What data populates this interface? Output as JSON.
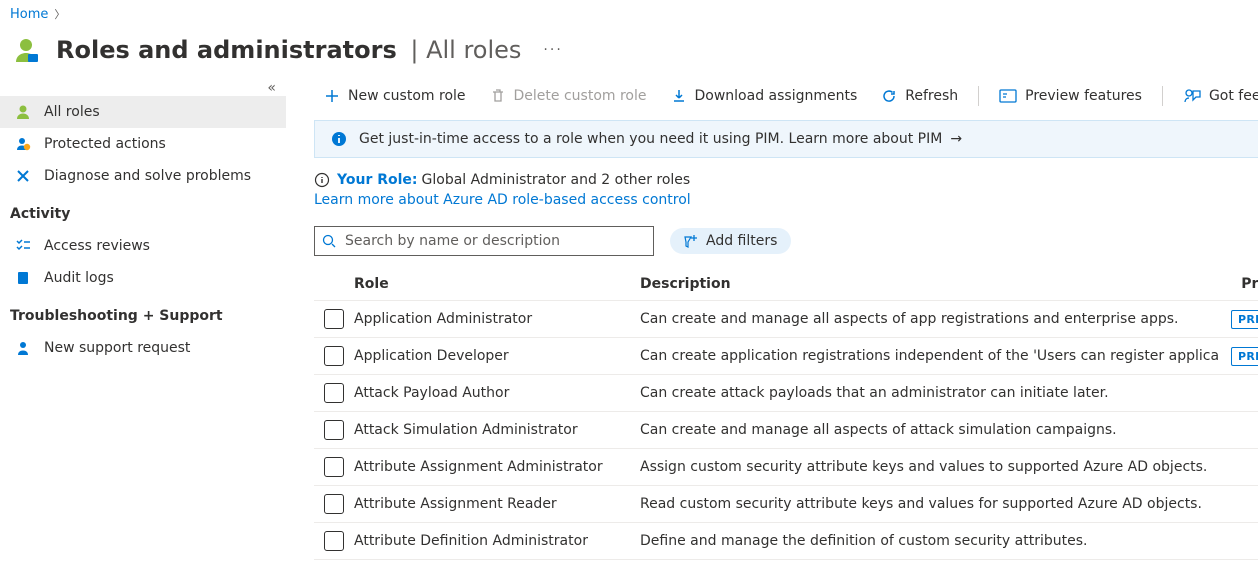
{
  "breadcrumb": {
    "home": "Home"
  },
  "header": {
    "title": "Roles and administrators",
    "subtitle": "All roles"
  },
  "sidebar": {
    "items": [
      {
        "label": "All roles"
      },
      {
        "label": "Protected actions"
      },
      {
        "label": "Diagnose and solve problems"
      }
    ],
    "sections": [
      {
        "title": "Activity",
        "items": [
          {
            "label": "Access reviews"
          },
          {
            "label": "Audit logs"
          }
        ]
      },
      {
        "title": "Troubleshooting + Support",
        "items": [
          {
            "label": "New support request"
          }
        ]
      }
    ]
  },
  "toolbar": {
    "new_role": "New custom role",
    "delete_role": "Delete custom role",
    "download": "Download assignments",
    "refresh": "Refresh",
    "preview": "Preview features",
    "feedback": "Got feedback?"
  },
  "banner": {
    "text": "Get just-in-time access to a role when you need it using PIM. Learn more about PIM"
  },
  "your_role": {
    "label": "Your Role:",
    "value": "Global Administrator and 2 other roles"
  },
  "learn_link": "Learn more about Azure AD role-based access control",
  "search": {
    "placeholder": "Search by name or description"
  },
  "add_filters": "Add filters",
  "columns": {
    "role": "Role",
    "description": "Description",
    "privileged": "Privileged"
  },
  "privileged_badge": "PRIVILEGED",
  "roles": [
    {
      "name": "Application Administrator",
      "description": "Can create and manage all aspects of app registrations and enterprise apps.",
      "privileged": true
    },
    {
      "name": "Application Developer",
      "description": "Can create application registrations independent of the 'Users can register applica",
      "privileged": true
    },
    {
      "name": "Attack Payload Author",
      "description": "Can create attack payloads that an administrator can initiate later.",
      "privileged": false
    },
    {
      "name": "Attack Simulation Administrator",
      "description": "Can create and manage all aspects of attack simulation campaigns.",
      "privileged": false
    },
    {
      "name": "Attribute Assignment Administrator",
      "description": "Assign custom security attribute keys and values to supported Azure AD objects.",
      "privileged": false
    },
    {
      "name": "Attribute Assignment Reader",
      "description": "Read custom security attribute keys and values for supported Azure AD objects.",
      "privileged": false
    },
    {
      "name": "Attribute Definition Administrator",
      "description": "Define and manage the definition of custom security attributes.",
      "privileged": false
    }
  ]
}
